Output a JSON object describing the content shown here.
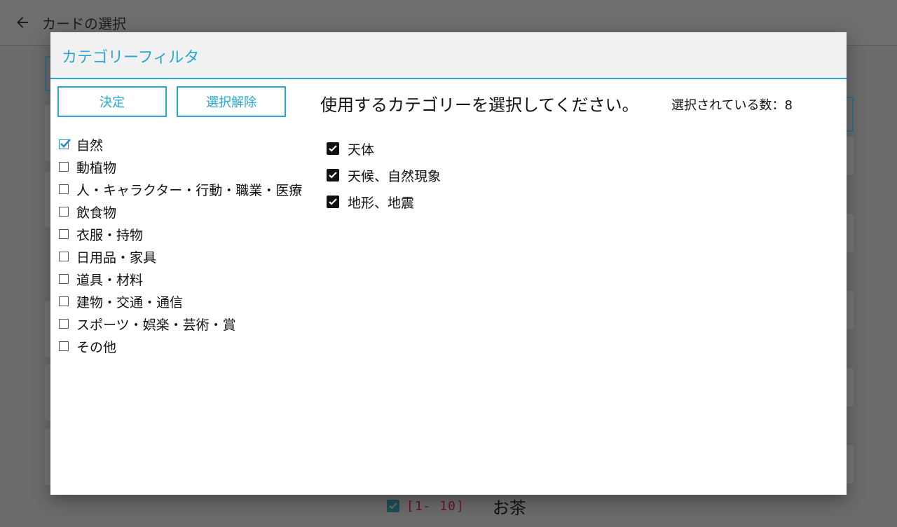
{
  "app": {
    "title": "カードの選択",
    "background_row": {
      "range": "[1- 10]",
      "name": "お茶",
      "checked": true
    }
  },
  "dialog": {
    "title": "カテゴリーフィルタ",
    "buttons": {
      "confirm": "決定",
      "clear": "選択解除"
    },
    "instruction": "使用するカテゴリーを選択してください。",
    "selected_count_label": "選択されている数：8",
    "categories": [
      {
        "label": "自然",
        "checked": true
      },
      {
        "label": "動植物",
        "checked": false
      },
      {
        "label": "人・キャラクター・行動・職業・医療",
        "checked": false
      },
      {
        "label": "飲食物",
        "checked": false
      },
      {
        "label": "衣服・持物",
        "checked": false
      },
      {
        "label": "日用品・家具",
        "checked": false
      },
      {
        "label": "道具・材料",
        "checked": false
      },
      {
        "label": "建物・交通・通信",
        "checked": false
      },
      {
        "label": "スポーツ・娯楽・芸術・賞",
        "checked": false
      },
      {
        "label": "その他",
        "checked": false
      }
    ],
    "subcategories": [
      {
        "label": "天体",
        "checked": true
      },
      {
        "label": "天候、自然現象",
        "checked": true
      },
      {
        "label": "地形、地震",
        "checked": true
      }
    ]
  },
  "colors": {
    "accent": "#29a6d1",
    "checkbox_checked": "#111111",
    "overlay": "#6b6b6b"
  }
}
